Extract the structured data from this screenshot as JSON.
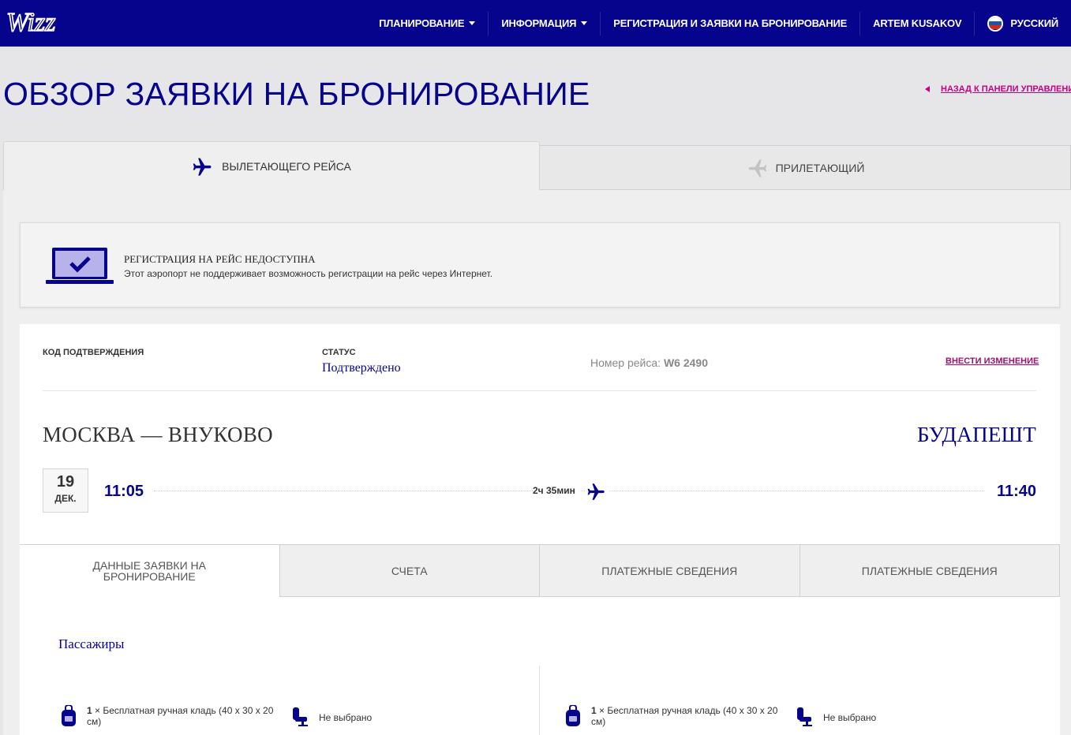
{
  "nav": {
    "logo_text": "Wizz",
    "items": [
      {
        "label": "ПЛАНИРОВАНИЕ",
        "dropdown": true
      },
      {
        "label": "ИНФОРМАЦИЯ",
        "dropdown": true
      },
      {
        "label": "РЕГИСТРАЦИЯ И ЗАЯВКИ НА БРОНИРОВАНИЕ",
        "dropdown": false
      },
      {
        "label": "ARTEM KUSAKOV",
        "dropdown": false
      }
    ],
    "language": "РУССКИЙ"
  },
  "page": {
    "title": "ОБЗОР ЗАЯВКИ НА БРОНИРОВАНИЕ",
    "back_link": "НАЗАД К ПАНЕЛИ УПРАВЛЕНИЯ"
  },
  "flight_tabs": {
    "outbound": "ВЫЛЕТАЮЩЕГО РЕЙСА",
    "inbound": "ПРИЛЕТАЮЩИЙ"
  },
  "notice": {
    "title": "РЕГИСТРАЦИЯ НА РЕЙС НЕДОСТУПНА",
    "text": "Этот аэропорт не поддерживает возможность регистрации на рейс через Интернет."
  },
  "booking": {
    "confirmation_label": "КОД ПОДТВЕРЖДЕНИЯ",
    "status_label": "СТАТУС",
    "status_value": "Подтверждено",
    "flight_number_label": "Номер рейса:",
    "flight_number": "W6 2490",
    "edit_link": "ВНЕСТИ ИЗМЕНЕНИЕ"
  },
  "route": {
    "from": "МОСКВА — ВНУКОВО",
    "to": "БУДАПЕШТ",
    "date_day": "19",
    "date_month": "ДЕК.",
    "departure_time": "11:05",
    "arrival_time": "11:40",
    "duration": "2ч 35мин"
  },
  "subtabs": [
    "ДАННЫЕ ЗАЯВКИ НА БРОНИРОВАНИЕ",
    "СЧЕТА",
    "ПЛАТЕЖНЫЕ СВЕДЕНИЯ",
    "ПЛАТЕЖНЫЕ СВЕДЕНИЯ"
  ],
  "passengers": {
    "title": "Пассажиры",
    "items": [
      {
        "bag_qty": "1",
        "bag_text": "× Бесплатная ручная кладь (40 x 30 x 20 см)",
        "seat_text": "Не выбрано"
      },
      {
        "bag_qty": "1",
        "bag_text": "× Бесплатная ручная кладь (40 x 30 x 20 см)",
        "seat_text": "Не выбрано"
      }
    ]
  },
  "colors": {
    "brand": "#06038d",
    "accent": "#c6007e"
  }
}
